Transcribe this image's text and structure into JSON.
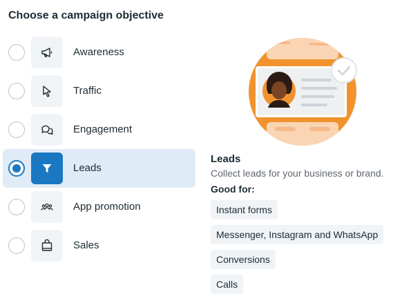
{
  "title": "Choose a campaign objective",
  "options": [
    {
      "label": "Awareness",
      "icon": "megaphone-icon",
      "selected": false
    },
    {
      "label": "Traffic",
      "icon": "cursor-icon",
      "selected": false
    },
    {
      "label": "Engagement",
      "icon": "chat-bubbles-icon",
      "selected": false
    },
    {
      "label": "Leads",
      "icon": "filter-icon",
      "selected": true
    },
    {
      "label": "App promotion",
      "icon": "people-icon",
      "selected": false
    },
    {
      "label": "Sales",
      "icon": "shopping-bag-icon",
      "selected": false
    }
  ],
  "detail": {
    "title": "Leads",
    "description": "Collect leads for your business or brand.",
    "good_for_label": "Good for:",
    "chips": [
      "Instant forms",
      "Messenger, Instagram and WhatsApp",
      "Conversions",
      "Calls"
    ]
  },
  "colors": {
    "accent": "#1a78c2",
    "selected_bg": "#dfecf7",
    "illustration_orange": "#f0932f"
  }
}
